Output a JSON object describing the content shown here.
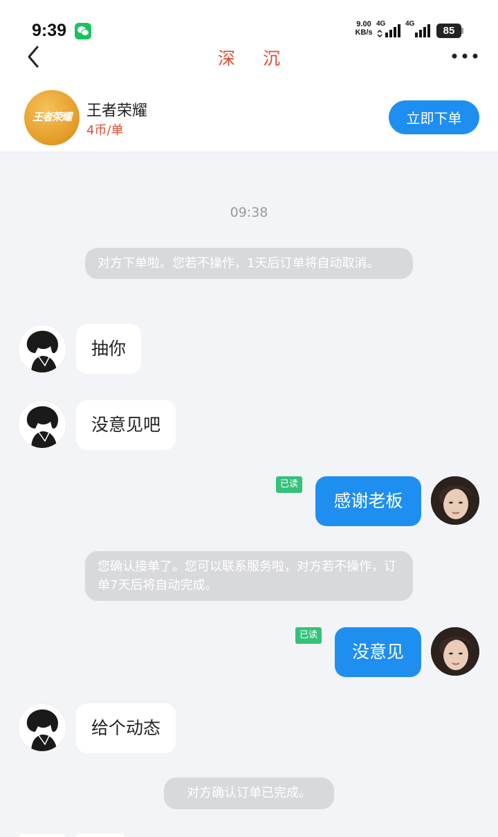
{
  "status_bar": {
    "time": "9:39",
    "speed_value": "9.00",
    "speed_unit": "KB/s",
    "network_1": "4G",
    "network_2": "4G",
    "battery": "85"
  },
  "header": {
    "title": "深 沉"
  },
  "order": {
    "logo_text": "王者荣耀",
    "game_name": "王者荣耀",
    "price": "4币/单",
    "order_button": "立即下单"
  },
  "chat": {
    "timestamp": "09:38",
    "sys_order_placed": "对方下单啦。您若不操作，1天后订单将自动取消。",
    "msg_1": "抽你",
    "msg_2": "没意见吧",
    "msg_3": "感谢老板",
    "read_label_1": "已读",
    "sys_order_accepted": "您确认接单了。您可以联系服务啦，对方若不操作，订单7天后将自动完成。",
    "msg_4": "没意见",
    "read_label_2": "已读",
    "msg_5": "给个动态",
    "sys_order_completed": "对方确认订单已完成。"
  },
  "colors": {
    "accent_blue": "#1f8ef1",
    "title_red": "#e24a32",
    "read_green": "#34c27a",
    "system_bubble": "#d8d9dd"
  }
}
